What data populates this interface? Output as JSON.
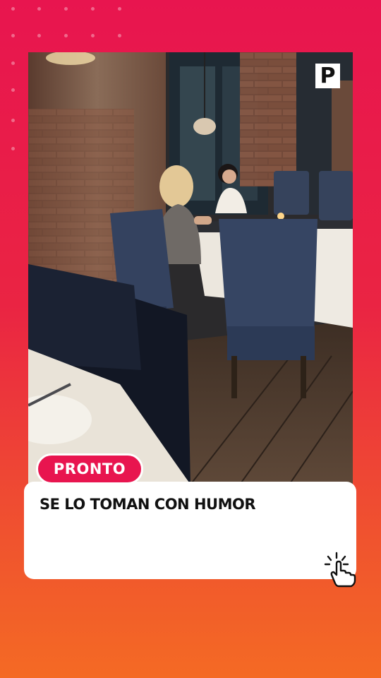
{
  "brand": {
    "logo_letter": "P"
  },
  "category_badge": {
    "label": "PRONTO"
  },
  "headline": {
    "text": "SE LO TOMAN CON HUMOR"
  },
  "icons": {
    "tap": "tap-hand-icon",
    "logo": "pronto-logo-icon"
  },
  "colors": {
    "accent": "#e8154f",
    "gradient_bottom": "#f46a24",
    "card": "#ffffff"
  }
}
